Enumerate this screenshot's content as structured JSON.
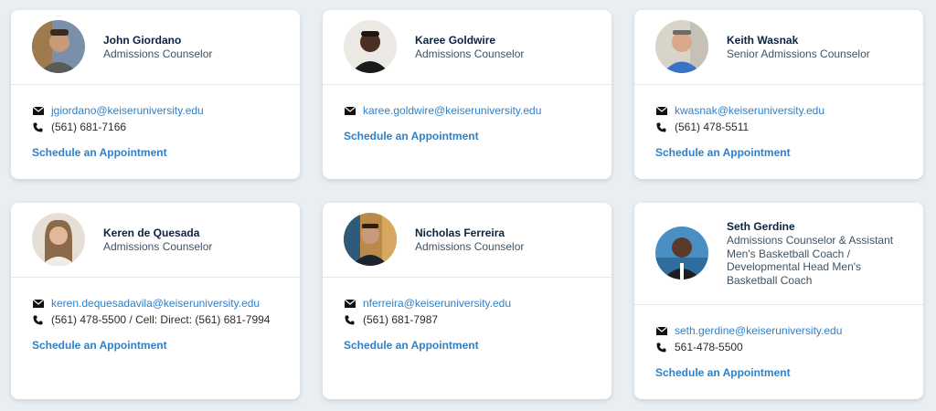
{
  "colors": {
    "background": "#e9eef2",
    "link": "#2f80c9",
    "name": "#0b2340",
    "role": "#3f5364"
  },
  "counselors": [
    {
      "name": "John Giordano",
      "role": "Admissions Counselor",
      "email": "jgiordano@keiseruniversity.edu",
      "phone": "(561) 681-7166",
      "schedule": "Schedule an Appointment"
    },
    {
      "name": "Karee Goldwire",
      "role": "Admissions Counselor",
      "email": "karee.goldwire@keiseruniversity.edu",
      "schedule": "Schedule an Appointment"
    },
    {
      "name": "Keith Wasnak",
      "role": "Senior Admissions Counselor",
      "email": "kwasnak@keiseruniversity.edu",
      "phone": "(561) 478-5511",
      "schedule": "Schedule an Appointment"
    },
    {
      "name": "Keren de Quesada",
      "role": "Admissions Counselor",
      "email": "keren.dequesadavila@keiseruniversity.edu",
      "phone": "(561) 478-5500 / Cell: Direct: (561) 681-7994",
      "schedule": "Schedule an Appointment"
    },
    {
      "name": "Nicholas Ferreira",
      "role": "Admissions Counselor",
      "email": "nferreira@keiseruniversity.edu",
      "phone": "(561) 681-7987",
      "schedule": "Schedule an Appointment"
    },
    {
      "name": "Seth Gerdine",
      "role_lines": [
        "Admissions Counselor & Assistant",
        "Men's Basketball Coach /",
        "Developmental Head Men's",
        "Basketball Coach"
      ],
      "email": "seth.gerdine@keiseruniversity.edu",
      "phone": "561-478-5500",
      "schedule": "Schedule an Appointment"
    }
  ]
}
